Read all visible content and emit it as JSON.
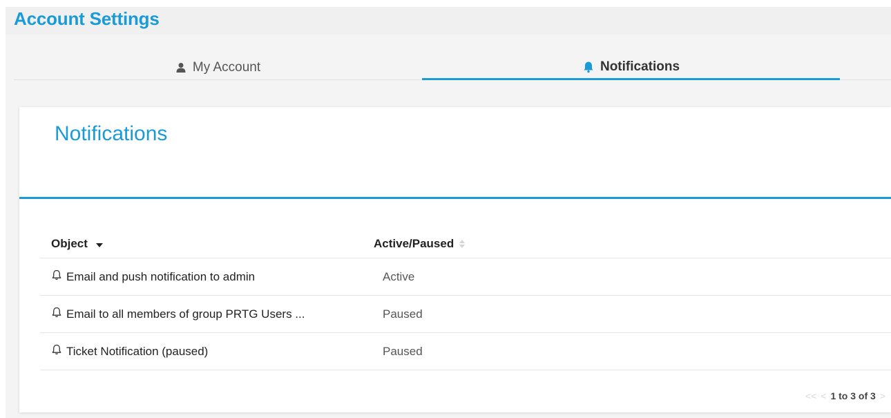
{
  "header": {
    "title": "Account Settings"
  },
  "tabs": [
    {
      "label": "My Account",
      "icon": "user-icon",
      "active": false
    },
    {
      "label": "Notifications",
      "icon": "bell-icon",
      "active": true
    }
  ],
  "card": {
    "title": "Notifications"
  },
  "table": {
    "columns": [
      {
        "label": "Object",
        "sort": "descending"
      },
      {
        "label": "Active/Paused",
        "sort": "none"
      }
    ],
    "rows": [
      {
        "object": "Email and push notification to admin",
        "status": "Active",
        "icon": "bell-outline-icon"
      },
      {
        "object": "Email to all members of group PRTG Users ...",
        "status": "Paused",
        "icon": "bell-outline-icon"
      },
      {
        "object": "Ticket Notification (paused)",
        "status": "Paused",
        "icon": "bell-outline-icon"
      }
    ]
  },
  "pagination": {
    "first": "<<",
    "prev": "<",
    "range": "1 to 3 of 3",
    "next": ">"
  },
  "colors": {
    "accent": "#1a9bd7",
    "tab_bg": "#f4f4f4",
    "title_bar_bg": "#f0f0f0"
  }
}
